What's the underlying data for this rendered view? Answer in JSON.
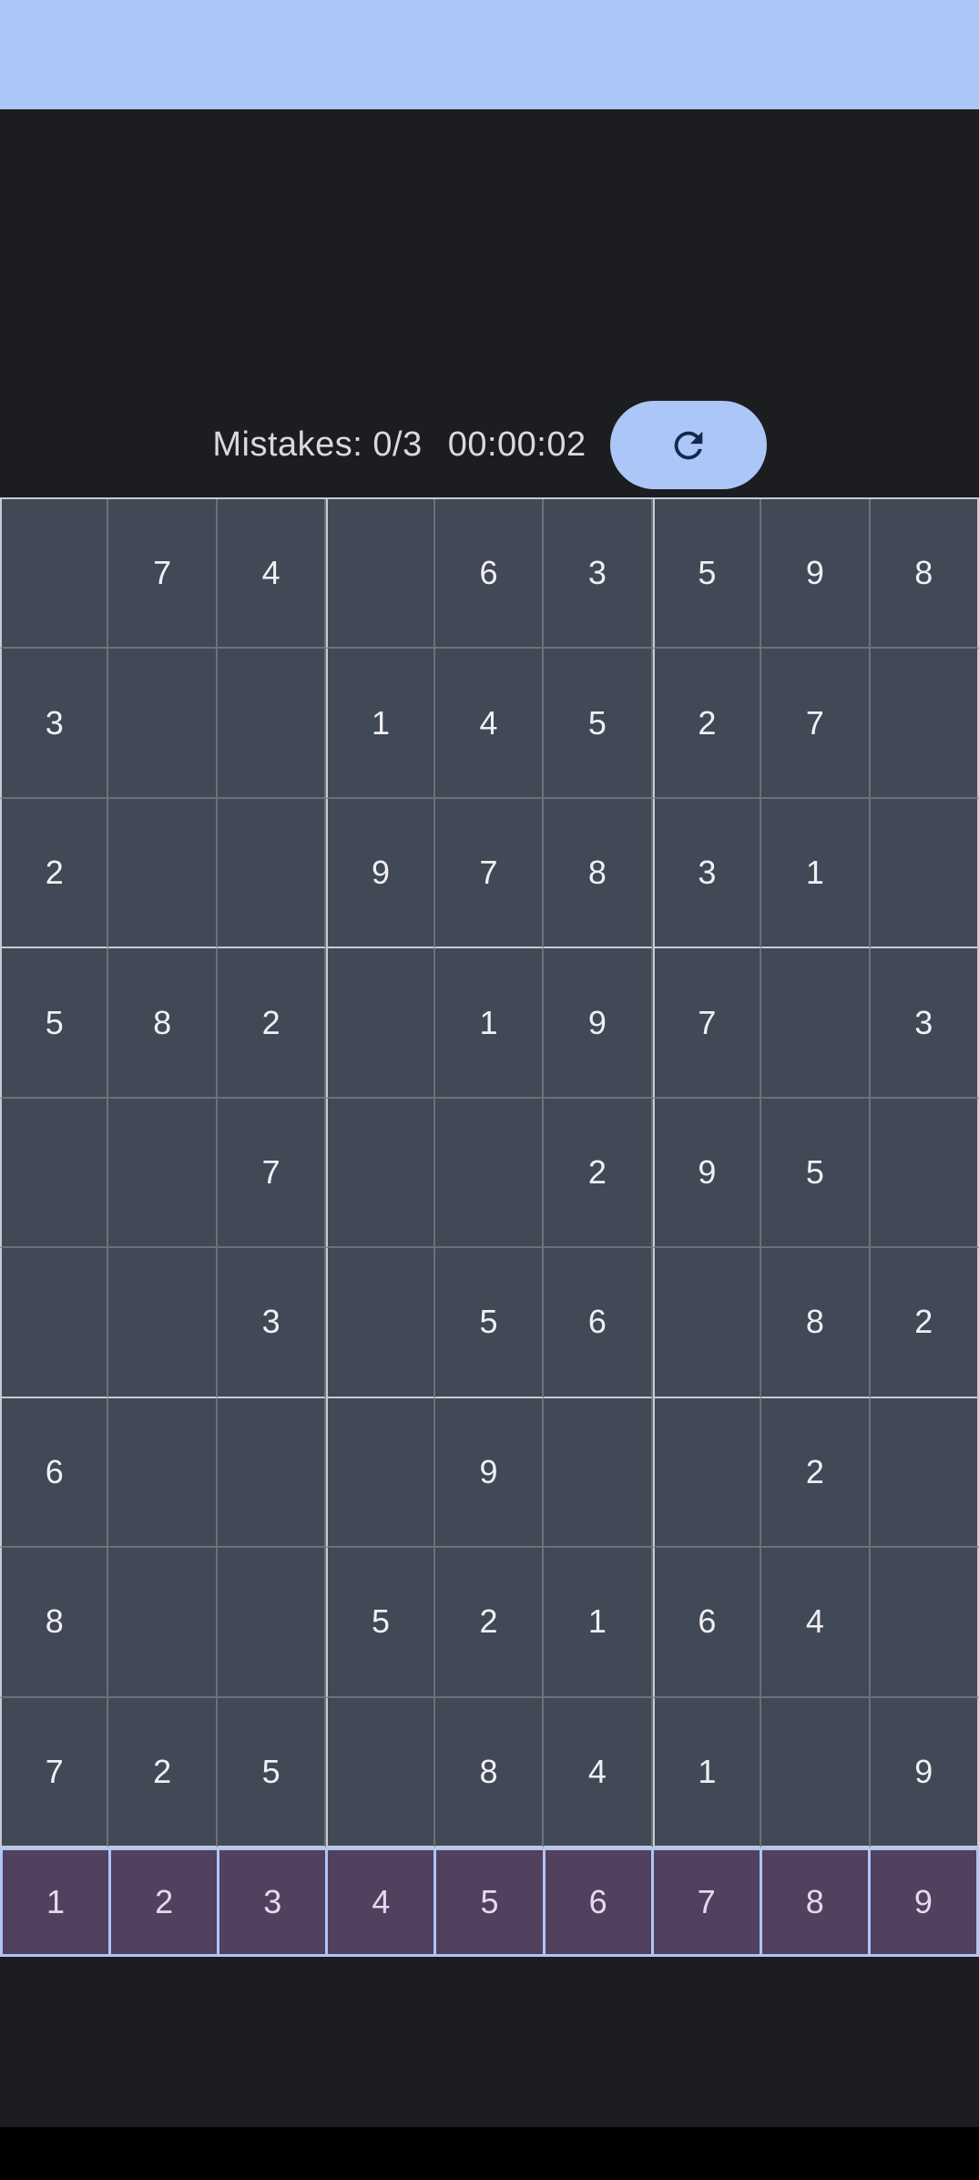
{
  "header": {
    "bar_color": "#adc6f8"
  },
  "status": {
    "mistakes": "Mistakes: 0/3",
    "timer": "00:00:02",
    "refresh_icon": "refresh-icon"
  },
  "board": {
    "rows": [
      [
        "",
        "7",
        "4",
        "",
        "6",
        "3",
        "5",
        "9",
        "8"
      ],
      [
        "3",
        "",
        "",
        "1",
        "4",
        "5",
        "2",
        "7",
        ""
      ],
      [
        "2",
        "",
        "",
        "9",
        "7",
        "8",
        "3",
        "1",
        ""
      ],
      [
        "5",
        "8",
        "2",
        "",
        "1",
        "9",
        "7",
        "",
        "3"
      ],
      [
        "",
        "",
        "7",
        "",
        "",
        "2",
        "9",
        "5",
        ""
      ],
      [
        "",
        "",
        "3",
        "",
        "5",
        "6",
        "",
        "8",
        "2"
      ],
      [
        "6",
        "",
        "",
        "",
        "9",
        "",
        "",
        "2",
        ""
      ],
      [
        "8",
        "",
        "",
        "5",
        "2",
        "1",
        "6",
        "4",
        ""
      ],
      [
        "7",
        "2",
        "5",
        "",
        "8",
        "4",
        "1",
        "",
        "9"
      ]
    ]
  },
  "numpad": {
    "keys": [
      "1",
      "2",
      "3",
      "4",
      "5",
      "6",
      "7",
      "8",
      "9"
    ]
  },
  "colors": {
    "accent": "#adc6f8",
    "cell_bg": "#414856",
    "numpad_bg": "#533f5e",
    "page_bg": "#1c1d21"
  }
}
